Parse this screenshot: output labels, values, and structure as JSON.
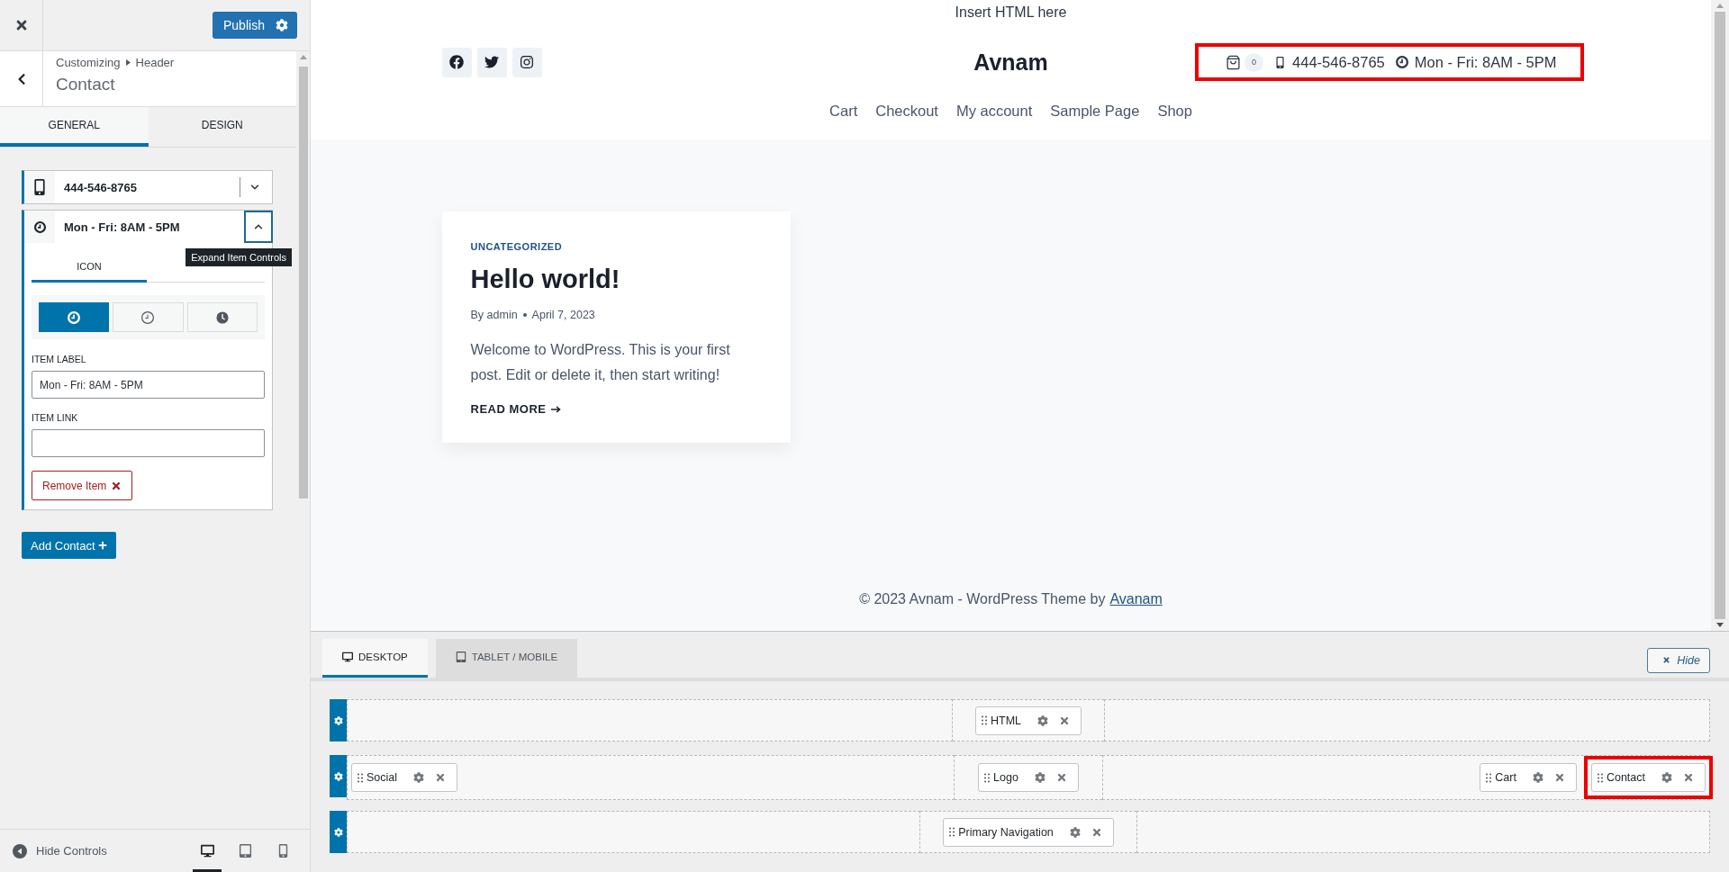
{
  "customizer": {
    "publish": "Publish",
    "breadcrumb": {
      "root": "Customizing",
      "section": "Header"
    },
    "title": "Contact"
  },
  "panel_tabs": [
    {
      "label": "GENERAL",
      "selected": true
    },
    {
      "label": "DESIGN",
      "selected": false
    }
  ],
  "contact_items": [
    {
      "kind": "phone",
      "label": "444-546-8765",
      "expanded": false
    },
    {
      "kind": "clock",
      "label": "Mon - Fri: 8AM - 5PM",
      "expanded": true,
      "tooltip": "Expand Item Controls",
      "icon_tabs": [
        {
          "label": "ICON",
          "selected": true
        }
      ],
      "icon_choices": [
        {
          "kind": "bold",
          "selected": true
        },
        {
          "kind": "thin",
          "selected": false
        },
        {
          "kind": "solid",
          "selected": false
        }
      ],
      "item_label": {
        "label": "ITEM LABEL",
        "value": "Mon - Fri: 8AM - 5PM"
      },
      "item_link": {
        "label": "ITEM LINK"
      },
      "remove": "Remove Item"
    }
  ],
  "add_contact": "Add Contact",
  "panel_footer": {
    "hide_controls": "Hide Controls",
    "devices": [
      {
        "kind": "desktop",
        "selected": true
      },
      {
        "kind": "tablet",
        "selected": false
      },
      {
        "kind": "mobile",
        "selected": false
      }
    ]
  },
  "preview": {
    "html": "Insert HTML here",
    "social": [
      {
        "kind": "facebook"
      },
      {
        "kind": "twitter"
      },
      {
        "kind": "instagram"
      }
    ],
    "logo": "Avnam",
    "cart_count": "0",
    "contacts": {
      "highlighted": true,
      "items": [
        {
          "kind": "phone",
          "label": "444-546-8765"
        },
        {
          "kind": "clock",
          "label": "Mon - Fri: 8AM - 5PM"
        }
      ]
    },
    "nav": [
      "Cart",
      "Checkout",
      "My account",
      "Sample Page",
      "Shop"
    ],
    "post": {
      "category": "UNCATEGORIZED",
      "title": "Hello world!",
      "author": "By admin",
      "date": "April 7, 2023",
      "excerpt": "Welcome to WordPress. This is your first post. Edit or delete it, then start writing!",
      "read_more": "READ MORE"
    },
    "footer": {
      "text": "© 2023 Avnam - WordPress Theme by",
      "link": "Avanam"
    }
  },
  "builder": {
    "tabs": [
      {
        "kind": "desktop",
        "label": "DESKTOP",
        "selected": true
      },
      {
        "kind": "tablet",
        "label": "TABLET / MOBILE",
        "selected": false
      }
    ],
    "hide": "Hide",
    "rows": [
      {
        "left": [],
        "center": [
          {
            "label": "HTML",
            "highlighted": false
          }
        ],
        "right": []
      },
      {
        "left": [
          {
            "label": "Social",
            "highlighted": false
          }
        ],
        "center": [
          {
            "label": "Logo",
            "highlighted": false
          }
        ],
        "right": [
          {
            "label": "Cart",
            "highlighted": false
          },
          {
            "label": "Contact",
            "highlighted": true
          }
        ]
      },
      {
        "left": [],
        "center": [
          {
            "label": "Primary Navigation",
            "highlighted": false
          }
        ],
        "right": []
      }
    ]
  }
}
